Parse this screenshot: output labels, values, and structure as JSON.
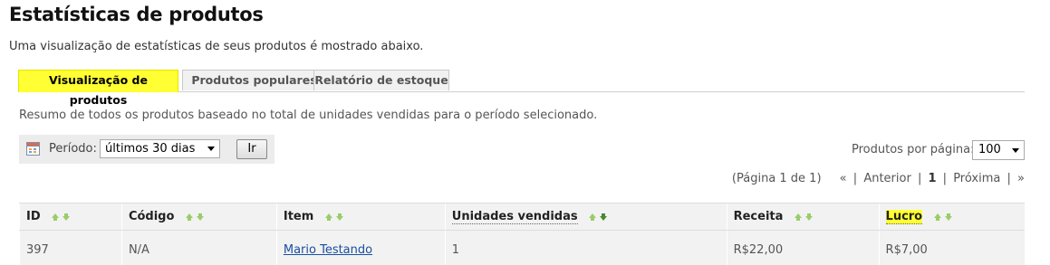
{
  "page": {
    "title": "Estatísticas de produtos",
    "intro": "Uma visualização de estatísticas de seus produtos é mostrado abaixo."
  },
  "tabs": [
    {
      "label": "Visualização de produtos",
      "active": true
    },
    {
      "label": "Produtos populares",
      "active": false
    },
    {
      "label": "Relatório de estoque",
      "active": false
    }
  ],
  "summary": "Resumo de todos os produtos baseado no total de unidades vendidas para o período selecionado.",
  "period": {
    "label": "Período:",
    "selected": "últimos 30 dias",
    "button": "Ir",
    "icon": "calendar-icon"
  },
  "per_page": {
    "label": "Produtos por página:",
    "selected": "100"
  },
  "pagination": {
    "info": "(Página 1 de 1)",
    "first": "«",
    "prev": "Anterior",
    "current": "1",
    "next": "Próxima",
    "last": "»"
  },
  "table": {
    "columns": [
      "ID",
      "Código",
      "Item",
      "Unidades vendidas",
      "Receita",
      "Lucro"
    ],
    "rows": [
      {
        "id": "397",
        "code": "N/A",
        "item": "Mario Testando",
        "units": "1",
        "revenue": "R$22,00",
        "profit": "R$7,00"
      }
    ]
  },
  "colors": {
    "highlight": "#ffff33",
    "sort_arrow": "#9acd6a",
    "link": "#1a4fa0"
  }
}
